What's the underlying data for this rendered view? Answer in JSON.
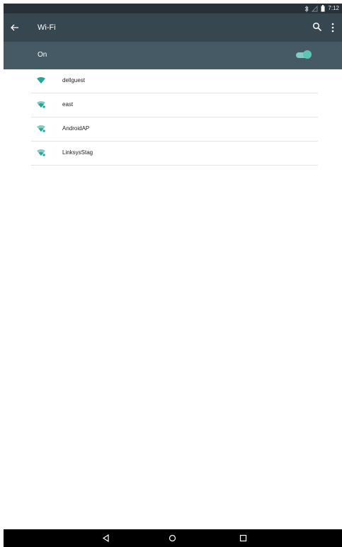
{
  "status_bar": {
    "time": "7:12",
    "icons": [
      "bluetooth-icon",
      "signal-icon",
      "battery-icon"
    ]
  },
  "app_bar": {
    "title": "Wi-Fi",
    "back_icon": "arrow-back-icon",
    "search_icon": "search-icon",
    "overflow_icon": "more-vert-icon"
  },
  "wifi_switch": {
    "label": "On",
    "state": "on"
  },
  "networks": [
    {
      "name": "dellguest",
      "icon": "wifi-full-icon"
    },
    {
      "name": "east",
      "icon": "wifi-locked-icon"
    },
    {
      "name": "AndroidAP",
      "icon": "wifi-locked-icon"
    },
    {
      "name": "LinksysStag",
      "icon": "wifi-locked-icon"
    }
  ],
  "colors": {
    "status_bar": "#263238",
    "app_bar": "#37474f",
    "switch_bar": "#455a64",
    "accent": "#5ec4b8"
  },
  "nav_bar": {
    "buttons": [
      "back-triangle-icon",
      "home-circle-icon",
      "recents-square-icon"
    ]
  }
}
